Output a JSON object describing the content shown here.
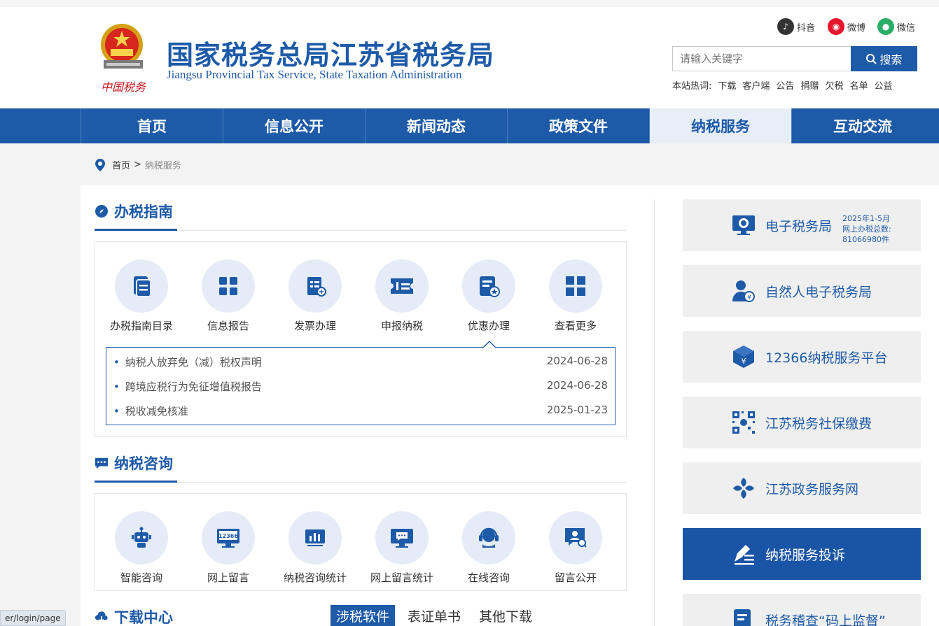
{
  "header": {
    "title": "国家税务总局江苏省税务局",
    "subtitle": "Jiangsu Provincial Tax Service, State Taxation Administration",
    "emblem_text": "中国税务",
    "social": [
      {
        "label": "抖音",
        "icon": "douyin-icon",
        "color": "#333333"
      },
      {
        "label": "微博",
        "icon": "weibo-icon",
        "color": "#e6162d"
      },
      {
        "label": "微信",
        "icon": "wechat-icon",
        "color": "#2aae67"
      }
    ],
    "search": {
      "placeholder": "请输入关键字",
      "button": "搜索"
    },
    "hot": {
      "label": "本站热词:",
      "words": [
        "下载",
        "客户端",
        "公告",
        "捐赠",
        "欠税",
        "名单",
        "公益"
      ]
    }
  },
  "nav": {
    "items": [
      "首页",
      "信息公开",
      "新闻动态",
      "政策文件",
      "纳税服务",
      "互动交流"
    ],
    "active": "纳税服务"
  },
  "breadcrumb": {
    "home": "首页",
    "sep": ">",
    "current": "纳税服务"
  },
  "guide": {
    "title": "办税指南",
    "items": [
      {
        "label": "办税指南目录",
        "icon": "document-list-icon"
      },
      {
        "label": "信息报告",
        "icon": "grid-icon"
      },
      {
        "label": "发票办理",
        "icon": "invoice-icon"
      },
      {
        "label": "申报纳税",
        "icon": "ticket-icon"
      },
      {
        "label": "优惠办理",
        "icon": "discount-doc-icon"
      },
      {
        "label": "查看更多",
        "icon": "more-grid-icon"
      }
    ],
    "list": [
      {
        "title": "纳税人放弃免（减）税权声明",
        "date": "2024-06-28"
      },
      {
        "title": "跨境应税行为免征增值税报告",
        "date": "2024-06-28"
      },
      {
        "title": "税收减免核准",
        "date": "2025-01-23"
      }
    ]
  },
  "consult": {
    "title": "纳税咨询",
    "items": [
      {
        "label": "智能咨询",
        "icon": "robot-icon"
      },
      {
        "label": "网上留言",
        "icon": "monitor-12366-icon"
      },
      {
        "label": "纳税咨询统计",
        "icon": "bar-chart-icon"
      },
      {
        "label": "网上留言统计",
        "icon": "monitor-chat-icon"
      },
      {
        "label": "在线咨询",
        "icon": "headset-icon"
      },
      {
        "label": "留言公开",
        "icon": "public-message-icon"
      }
    ],
    "monitor_text": "12366"
  },
  "download": {
    "title": "下载中心",
    "tabs": [
      "涉税软件",
      "表证单书",
      "其他下载"
    ],
    "active": "涉税软件"
  },
  "sidebar": {
    "cards": [
      {
        "label": "电子税务局",
        "icon": "etax-icon",
        "stats": [
          "2025年1-5月",
          "网上办税总数:",
          "81066980件"
        ]
      },
      {
        "label": "自然人电子税务局",
        "icon": "person-tax-icon"
      },
      {
        "label": "12366纳税服务平台",
        "icon": "cube-service-icon"
      },
      {
        "label": "江苏税务社保缴费",
        "icon": "qr-code-icon"
      },
      {
        "label": "江苏政务服务网",
        "icon": "gov-service-icon"
      },
      {
        "label": "纳税服务投诉",
        "icon": "pen-complaint-icon"
      },
      {
        "label": "税务稽查“码上监督”",
        "icon": "supervise-doc-icon"
      }
    ],
    "active": "纳税服务投诉"
  },
  "status_bar": {
    "url": "er/login/page"
  },
  "colors": {
    "brand": "#1d5aa8",
    "nav_active_bg": "#e8eef8",
    "card_bg": "#efefef"
  }
}
